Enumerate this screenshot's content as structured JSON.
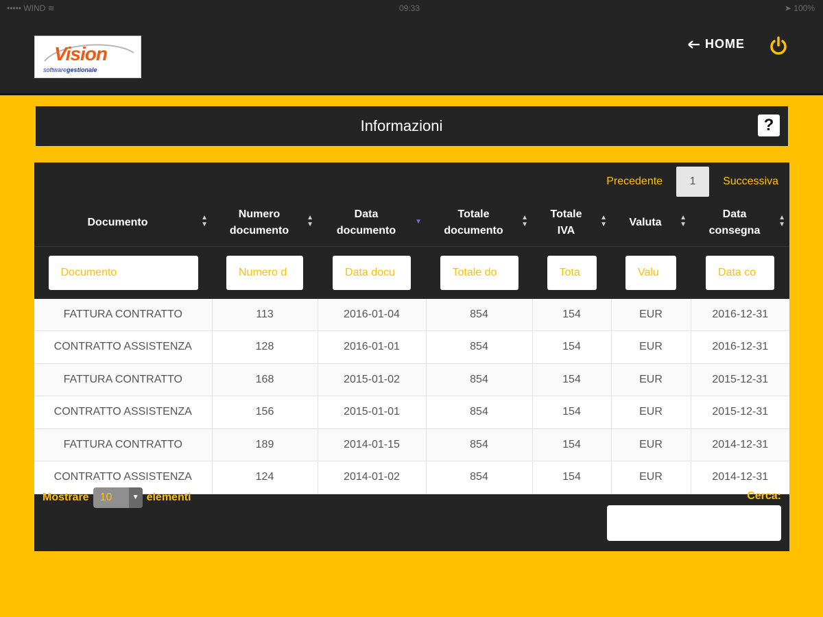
{
  "status_bar": {
    "carrier": "••••• WIND ≋",
    "time": "09:33",
    "battery": "➤ 100%"
  },
  "header": {
    "logo_main": "Vision",
    "logo_sub_a": "software",
    "logo_sub_b": "gestionale",
    "home_label": "HOME",
    "home_icon": "arrow-left-icon",
    "power_icon": "power-icon"
  },
  "panel": {
    "title": "Informazioni",
    "help_icon": "?"
  },
  "pager": {
    "prev": "Precedente",
    "page": "1",
    "next": "Successiva"
  },
  "table": {
    "columns": [
      {
        "label_1": "Documento",
        "label_2": "",
        "placeholder": "Documento"
      },
      {
        "label_1": "Numero",
        "label_2": "documento",
        "placeholder": "Numero d"
      },
      {
        "label_1": "Data",
        "label_2": "documento",
        "placeholder": "Data docu"
      },
      {
        "label_1": "Totale",
        "label_2": "documento",
        "placeholder": "Totale do"
      },
      {
        "label_1": "Totale",
        "label_2": "IVA",
        "placeholder": "Tota"
      },
      {
        "label_1": "Valuta",
        "label_2": "",
        "placeholder": "Valu"
      },
      {
        "label_1": "Data",
        "label_2": "consegna",
        "placeholder": "Data co"
      }
    ],
    "rows": [
      [
        "FATTURA CONTRATTO",
        "113",
        "2016-01-04",
        "854",
        "154",
        "EUR",
        "2016-12-31"
      ],
      [
        "CONTRATTO ASSISTENZA",
        "128",
        "2016-01-01",
        "854",
        "154",
        "EUR",
        "2016-12-31"
      ],
      [
        "FATTURA CONTRATTO",
        "168",
        "2015-01-02",
        "854",
        "154",
        "EUR",
        "2015-12-31"
      ],
      [
        "CONTRATTO ASSISTENZA",
        "156",
        "2015-01-01",
        "854",
        "154",
        "EUR",
        "2015-12-31"
      ],
      [
        "FATTURA CONTRATTO",
        "189",
        "2014-01-15",
        "854",
        "154",
        "EUR",
        "2014-12-31"
      ],
      [
        "CONTRATTO ASSISTENZA",
        "124",
        "2014-01-02",
        "854",
        "154",
        "EUR",
        "2014-12-31"
      ]
    ]
  },
  "footer": {
    "show_label": "Mostrare",
    "page_size": "10",
    "elements_label": "elementi",
    "search_label": "Cerca:"
  },
  "colors": {
    "accent": "#FFC000",
    "dark": "#242424",
    "sort_active": "#6b6ed8"
  }
}
